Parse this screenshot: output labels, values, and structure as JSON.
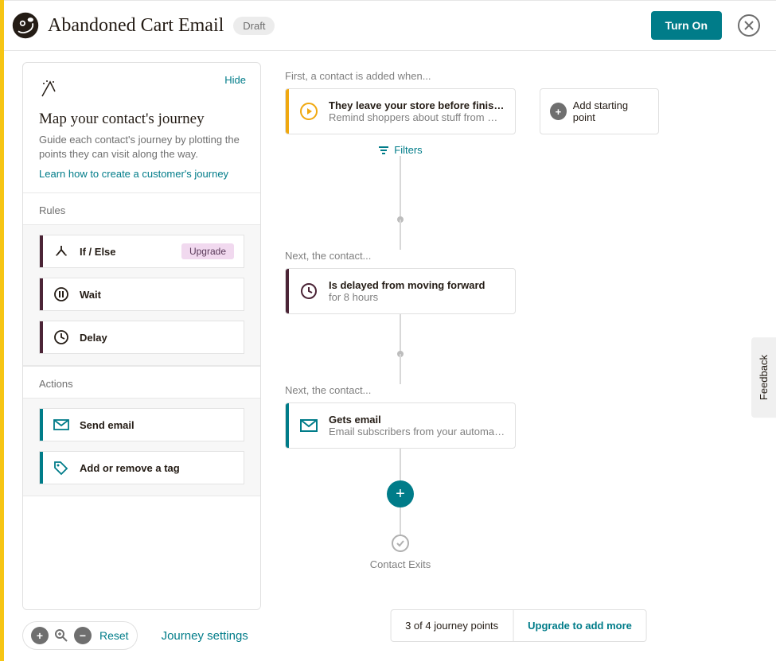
{
  "header": {
    "title": "Abandoned Cart Email",
    "status": "Draft",
    "turn_on": "Turn On"
  },
  "sidebar": {
    "hide": "Hide",
    "heading": "Map your contact's journey",
    "desc": "Guide each contact's journey by plotting the points they can visit along the way.",
    "learn_link": "Learn how to create a customer's journey",
    "rules_label": "Rules",
    "rules": [
      {
        "label": "If / Else",
        "badge": "Upgrade"
      },
      {
        "label": "Wait"
      },
      {
        "label": "Delay"
      }
    ],
    "actions_label": "Actions",
    "actions": [
      {
        "label": "Send email"
      },
      {
        "label": "Add or remove a tag"
      }
    ]
  },
  "canvas": {
    "step1_label": "First, a contact is added when...",
    "start": {
      "title": "They leave your store before finishing c...",
      "sub": "Remind shoppers about stuff from GetM..."
    },
    "add_start": "Add starting point",
    "filters": "Filters",
    "step2_label": "Next, the contact...",
    "delay": {
      "title": "Is delayed from moving forward",
      "sub": "for 8 hours"
    },
    "step3_label": "Next, the contact...",
    "email": {
      "title": "Gets email",
      "sub": "Email subscribers from your automation ..."
    },
    "exit": "Contact Exits"
  },
  "footer": {
    "reset": "Reset",
    "journey_settings": "Journey settings",
    "status": "3 of 4 journey points",
    "upgrade": "Upgrade to add more"
  },
  "feedback": "Feedback"
}
